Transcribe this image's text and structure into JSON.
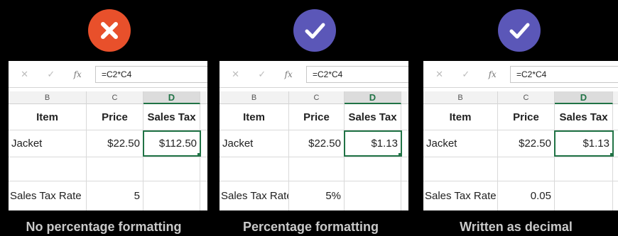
{
  "colors": {
    "wrong_badge": "#e8502b",
    "right_badge": "#5b57b8",
    "excel_green": "#217346",
    "caption": "#c9c9c9"
  },
  "panels": [
    {
      "badge_icon": "x-icon",
      "badge_symbol": "X",
      "formula": "=C2*C4",
      "columns": [
        "B",
        "C",
        "D"
      ],
      "headers": {
        "item": "Item",
        "price": "Price",
        "tax": "Sales Tax"
      },
      "row_item": {
        "label": "Jacket",
        "price": "$22.50",
        "tax": "$112.50"
      },
      "row_rate": {
        "label": "Sales Tax Rate",
        "value": "5"
      },
      "caption": "No percentage formatting"
    },
    {
      "badge_icon": "check-icon",
      "badge_symbol": "✓",
      "formula": "=C2*C4",
      "columns": [
        "B",
        "C",
        "D"
      ],
      "headers": {
        "item": "Item",
        "price": "Price",
        "tax": "Sales Tax"
      },
      "row_item": {
        "label": "Jacket",
        "price": "$22.50",
        "tax": "$1.13"
      },
      "row_rate": {
        "label": "Sales Tax Rate",
        "value": "5%"
      },
      "caption": "Percentage formatting"
    },
    {
      "badge_icon": "check-icon",
      "badge_symbol": "✓",
      "formula": "=C2*C4",
      "columns": [
        "B",
        "C",
        "D"
      ],
      "headers": {
        "item": "Item",
        "price": "Price",
        "tax": "Sales Tax"
      },
      "row_item": {
        "label": "Jacket",
        "price": "$22.50",
        "tax": "$1.13"
      },
      "row_rate": {
        "label": "Sales Tax Rate",
        "value": "0.05"
      },
      "caption": "Written as decimal"
    }
  ],
  "toolbar": {
    "cancel_glyph": "✕",
    "enter_glyph": "✓",
    "fx_label": "fx"
  }
}
